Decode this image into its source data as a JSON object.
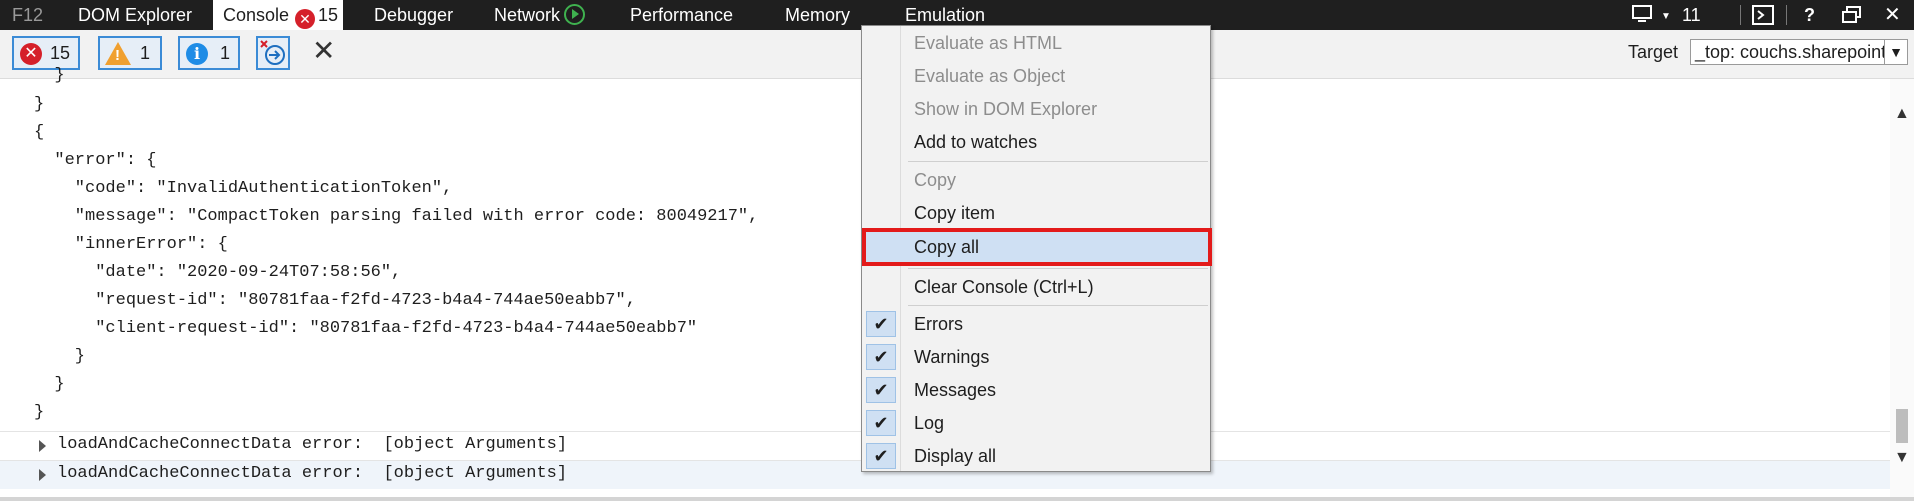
{
  "tabbar": {
    "f12": "F12",
    "tabs": [
      "DOM Explorer",
      "Console",
      "Debugger",
      "Network",
      "Performance",
      "Memory",
      "Emulation"
    ],
    "console_error_count": "15",
    "icon_network": "play-circle-icon",
    "right_count": "11",
    "colors": {
      "bar_bg": "#1f1f1f",
      "error_red": "#d5202a"
    }
  },
  "toolbar": {
    "errors_count": "15",
    "warnings_count": "1",
    "messages_count": "1",
    "target_label": "Target",
    "target_value": "_top: couchs.sharepoint"
  },
  "console": {
    "lines": [
      "  }",
      "}",
      "{",
      "  \"error\": {",
      "    \"code\": \"InvalidAuthenticationToken\",",
      "    \"message\": \"CompactToken parsing failed with error code: 80049217\",",
      "    \"innerError\": {",
      "      \"date\": \"2020-09-24T07:58:56\",",
      "      \"request-id\": \"80781faa-f2fd-4723-b4a4-744ae50eabb7\",",
      "      \"client-request-id\": \"80781faa-f2fd-4723-b4a4-744ae50eabb7\"",
      "    }",
      "  }",
      "}"
    ],
    "rows": [
      "loadAndCacheConnectData error:  [object Arguments]",
      "loadAndCacheConnectData error:  [object Arguments]"
    ]
  },
  "menu": {
    "evaluate_html": "Evaluate as HTML",
    "evaluate_object": "Evaluate as Object",
    "show_dom": "Show in DOM Explorer",
    "add_watches": "Add to watches",
    "copy": "Copy",
    "copy_item": "Copy item",
    "copy_all": "Copy all",
    "clear_console": "Clear Console (Ctrl+L)",
    "errors": "Errors",
    "warnings": "Warnings",
    "messages": "Messages",
    "log": "Log",
    "display_all": "Display all",
    "highlight_color": "#e31a1a"
  }
}
